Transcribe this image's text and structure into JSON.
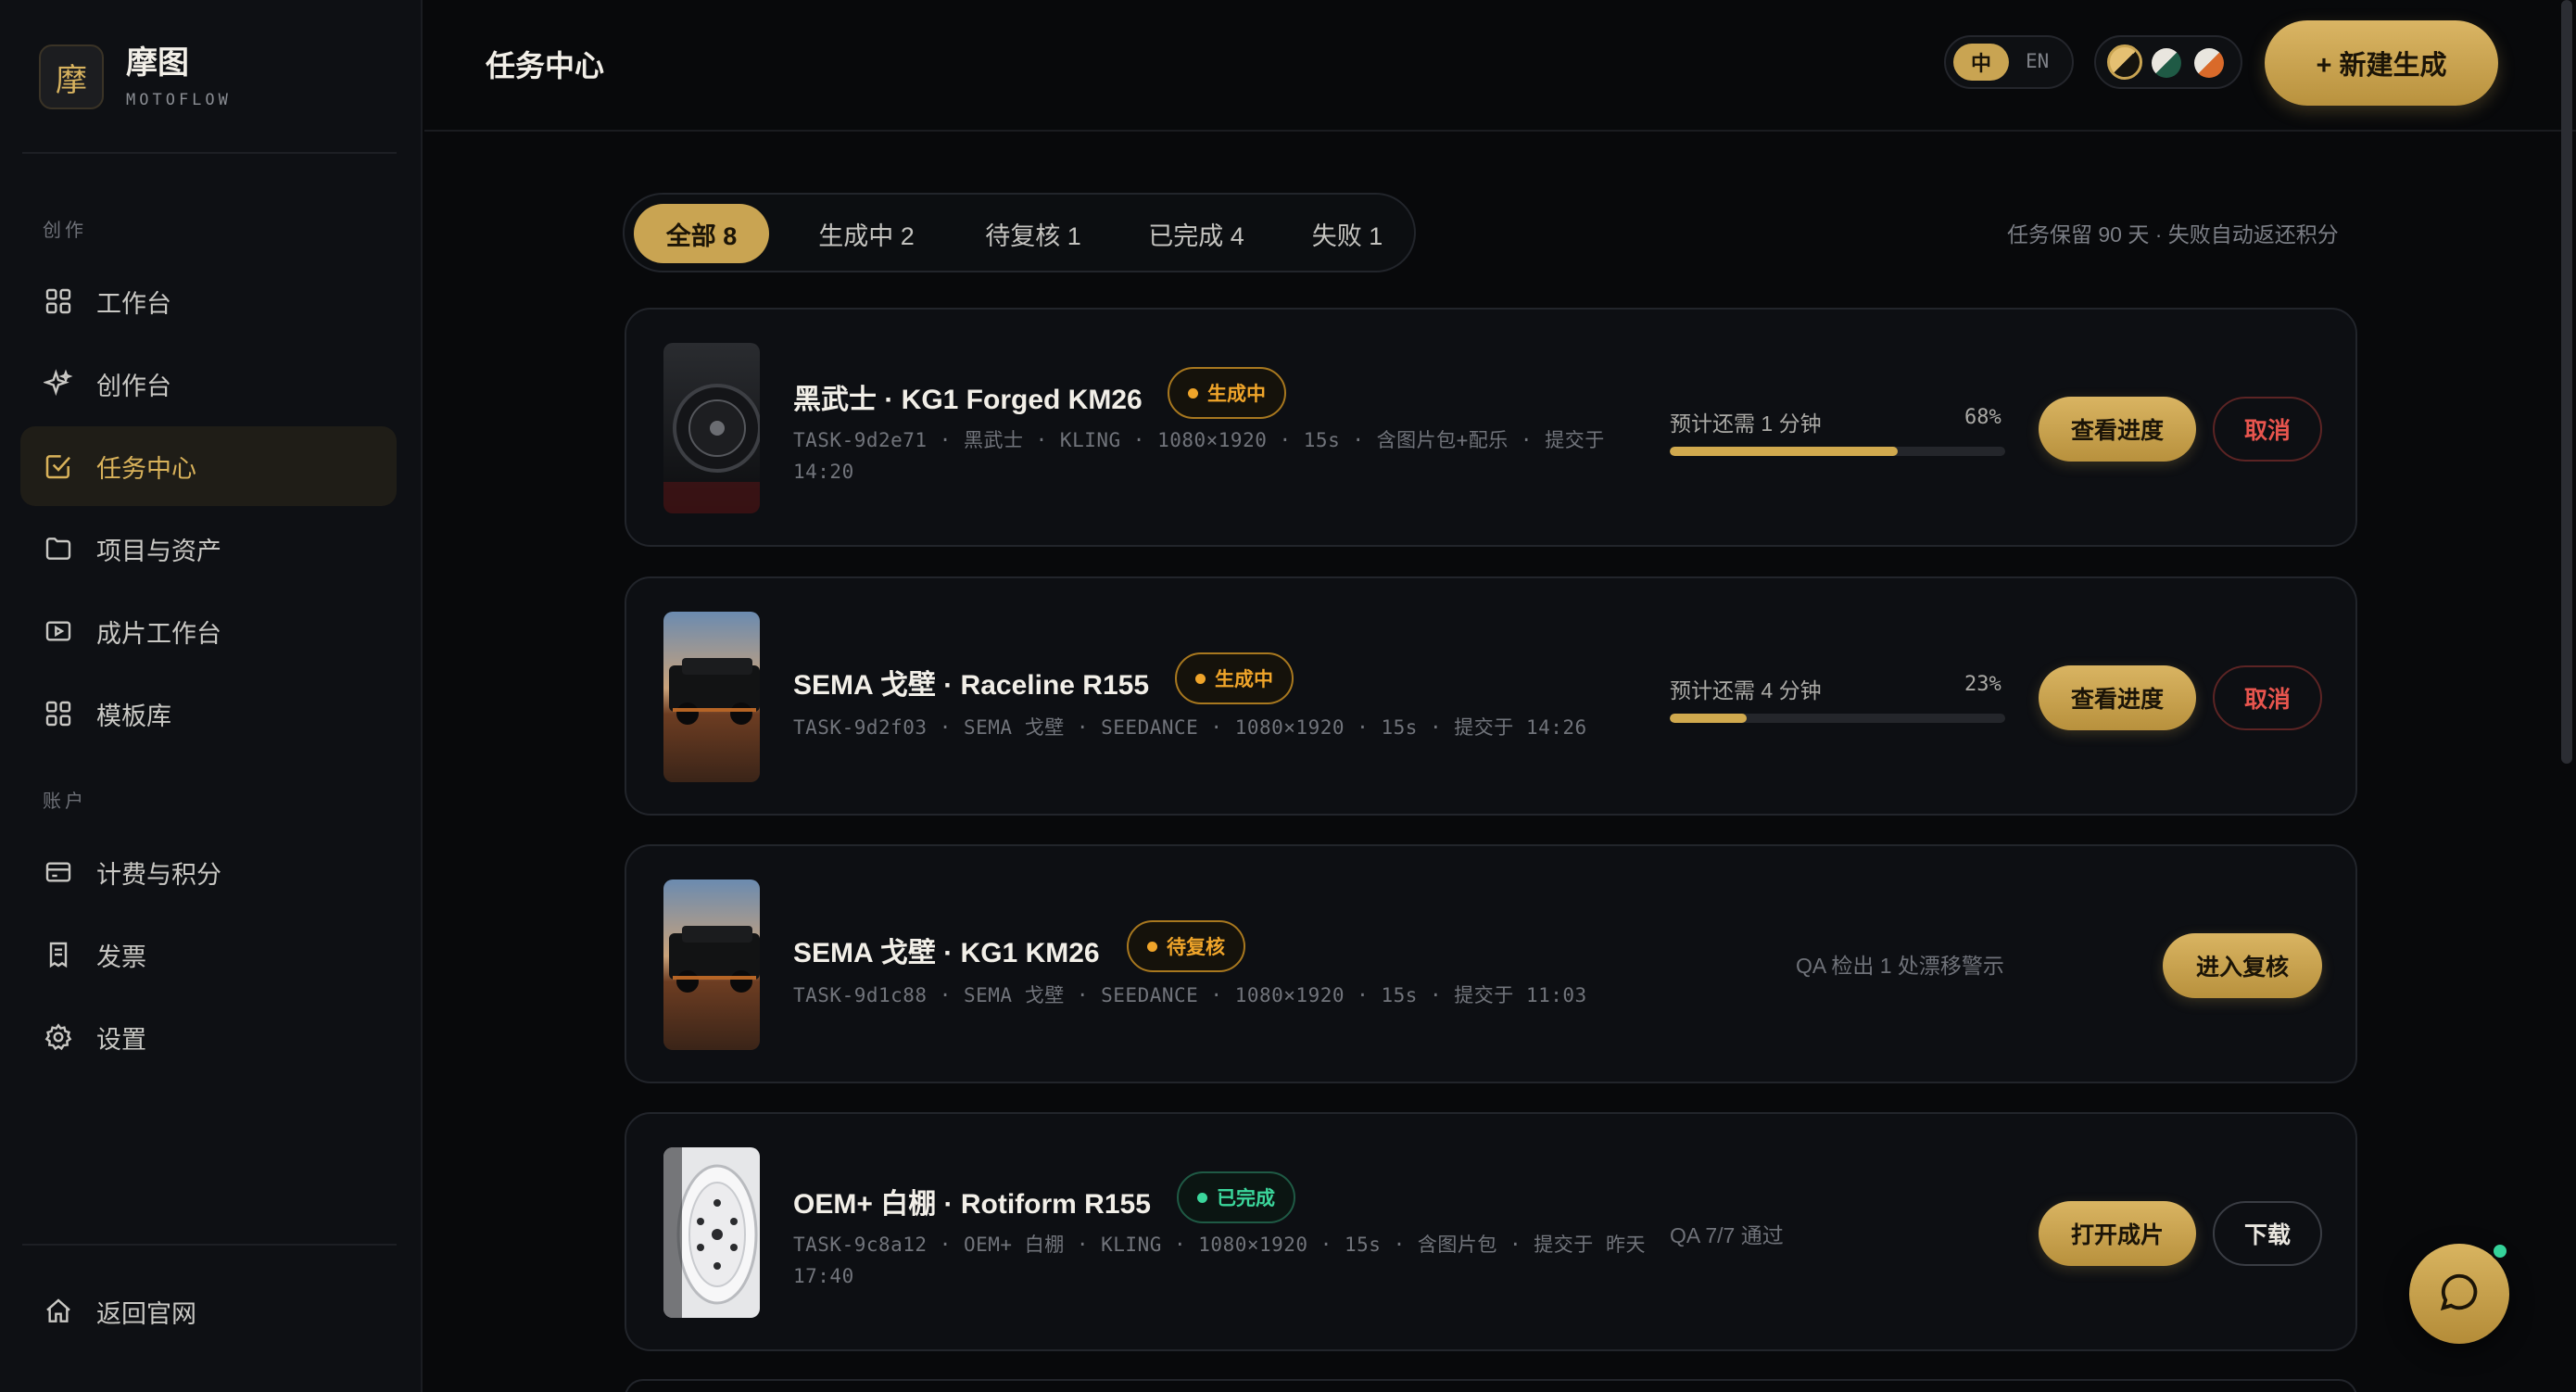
{
  "brand": {
    "logo_char": "摩",
    "name": "摩图",
    "subtitle": "MOTOFLOW"
  },
  "sidebar": {
    "section_create": "创作",
    "section_account": "账户",
    "items": [
      {
        "label": "工作台",
        "icon": "grid-icon"
      },
      {
        "label": "创作台",
        "icon": "sparkle-icon"
      },
      {
        "label": "任务中心",
        "icon": "checkbox-icon",
        "active": true
      },
      {
        "label": "项目与资产",
        "icon": "folder-icon"
      },
      {
        "label": "成片工作台",
        "icon": "play-icon"
      },
      {
        "label": "模板库",
        "icon": "grid-icon"
      },
      {
        "label": "计费与积分",
        "icon": "card-icon"
      },
      {
        "label": "发票",
        "icon": "receipt-icon"
      },
      {
        "label": "设置",
        "icon": "gear-icon"
      }
    ],
    "back_home": "返回官网"
  },
  "header": {
    "title": "任务中心",
    "lang_zh": "中",
    "lang_en": "EN",
    "new_button": "+ 新建生成"
  },
  "filters": {
    "tabs": [
      {
        "label": "全部 8",
        "active": true
      },
      {
        "label": "生成中 2"
      },
      {
        "label": "待复核 1"
      },
      {
        "label": "已完成 4"
      },
      {
        "label": "失败 1"
      }
    ],
    "retention_note": "任务保留 90 天 · 失败自动返还积分"
  },
  "tasks": [
    {
      "title": "黑武士 · KG1 Forged KM26",
      "status": "生成中",
      "meta": "TASK-9d2e71 · 黑武士 · KLING · 1080×1920 · 15s · 含图片包+配乐 · 提交于 14:20",
      "eta": "预计还需 1 分钟",
      "progress_label": "68%",
      "progress": 68,
      "primary_action": "查看进度",
      "secondary_action": "取消"
    },
    {
      "title": "SEMA 戈壁 · Raceline R155",
      "status": "生成中",
      "meta": "TASK-9d2f03 · SEMA 戈壁 · SEEDANCE · 1080×1920 · 15s · 提交于 14:26",
      "eta": "预计还需 4 分钟",
      "progress_label": "23%",
      "progress": 23,
      "primary_action": "查看进度",
      "secondary_action": "取消"
    },
    {
      "title": "SEMA 戈壁 · KG1 KM26",
      "status": "待复核",
      "meta": "TASK-9d1c88 · SEMA 戈壁 · SEEDANCE · 1080×1920 · 15s · 提交于 11:03",
      "note": "QA 检出 1 处漂移警示",
      "primary_action": "进入复核"
    },
    {
      "title": "OEM+ 白棚 · Rotiform R155",
      "status": "已完成",
      "meta": "TASK-9c8a12 · OEM+ 白棚 · KLING · 1080×1920 · 15s · 含图片包 · 提交于 昨天 17:40",
      "note": "QA 7/7 通过",
      "primary_action": "打开成片",
      "secondary_action": "下载"
    }
  ],
  "colors": {
    "accent": "#c9a452",
    "generating": "#f0a52a",
    "completed": "#3bd69b",
    "danger": "#e8554e",
    "background": "#08090b"
  }
}
